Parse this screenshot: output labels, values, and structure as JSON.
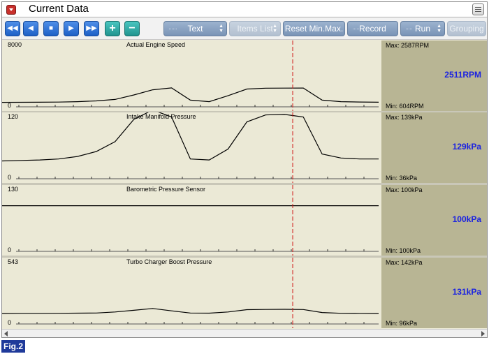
{
  "window": {
    "title": "Current Data"
  },
  "toolbar": {
    "nav_buttons": [
      {
        "name": "rewind-button",
        "glyph": "◀◀"
      },
      {
        "name": "step-back-button",
        "glyph": "◀"
      },
      {
        "name": "stop-button",
        "glyph": "■"
      },
      {
        "name": "play-button",
        "glyph": "▶"
      },
      {
        "name": "fast-forward-button",
        "glyph": "▶▶"
      },
      {
        "name": "zoom-in-button",
        "glyph": "+"
      },
      {
        "name": "zoom-out-button",
        "glyph": "−"
      }
    ],
    "text_label": "Text",
    "items_list_label": "Items List",
    "reset_label": "Reset Min.Max.",
    "record_label": "Record",
    "run_label": "Run",
    "grouping_label": "Grouping"
  },
  "figure_label": "Fig.2",
  "colors": {
    "trace": "#000000",
    "cursor": "#d11a1a",
    "value": "#1a22e0",
    "plot_bg": "#ebe9d6",
    "side_bg": "#b8b594"
  },
  "chart_data": [
    {
      "type": "line",
      "title": "Actual Engine Speed",
      "ylim": [
        0,
        8000
      ],
      "y_max_label": "8000",
      "y_min_label": "0",
      "max_label": "Max:  2587RPM",
      "min_label": "Min:   604RPM",
      "current_value": "2511RPM",
      "x": [
        0,
        5,
        10,
        15,
        20,
        25,
        30,
        35,
        40,
        45,
        50,
        55,
        60,
        65,
        70,
        75,
        80,
        85,
        90,
        95,
        100
      ],
      "y": [
        604,
        610,
        620,
        640,
        700,
        800,
        1000,
        1600,
        2300,
        2550,
        900,
        700,
        1500,
        2400,
        2511,
        2520,
        2530,
        900,
        700,
        650,
        620
      ]
    },
    {
      "type": "line",
      "title": "Intake Manifold Pressure",
      "ylim": [
        0,
        120
      ],
      "y_max_label": "120",
      "y_min_label": "0",
      "max_label": "Max:  139kPa",
      "min_label": "Min:    36kPa",
      "current_value": "129kPa",
      "x": [
        0,
        5,
        10,
        15,
        20,
        25,
        30,
        35,
        40,
        45,
        50,
        55,
        60,
        65,
        70,
        75,
        80,
        85,
        90,
        95,
        100
      ],
      "y": [
        36,
        37,
        38,
        40,
        45,
        55,
        75,
        120,
        139,
        125,
        40,
        38,
        60,
        115,
        129,
        130,
        125,
        50,
        42,
        40,
        40
      ]
    },
    {
      "type": "line",
      "title": "Barometric Pressure Sensor",
      "ylim": [
        0,
        130
      ],
      "y_max_label": "130",
      "y_min_label": "0",
      "max_label": "Max:  100kPa",
      "min_label": "Min:    100kPa",
      "current_value": "100kPa",
      "x": [
        0,
        100
      ],
      "y": [
        100,
        100
      ]
    },
    {
      "type": "line",
      "title": "Turbo Charger Boost Pressure",
      "ylim": [
        0,
        543
      ],
      "y_max_label": "543",
      "y_min_label": "0",
      "max_label": "Max:  142kPa",
      "min_label": "Min:     96kPa",
      "current_value": "131kPa",
      "x": [
        0,
        5,
        10,
        15,
        20,
        25,
        30,
        35,
        40,
        45,
        50,
        55,
        60,
        65,
        70,
        75,
        80,
        85,
        90,
        95,
        100
      ],
      "y": [
        96,
        97,
        97,
        98,
        99,
        100,
        110,
        125,
        142,
        120,
        100,
        99,
        110,
        131,
        133,
        134,
        132,
        105,
        98,
        97,
        96
      ]
    }
  ]
}
